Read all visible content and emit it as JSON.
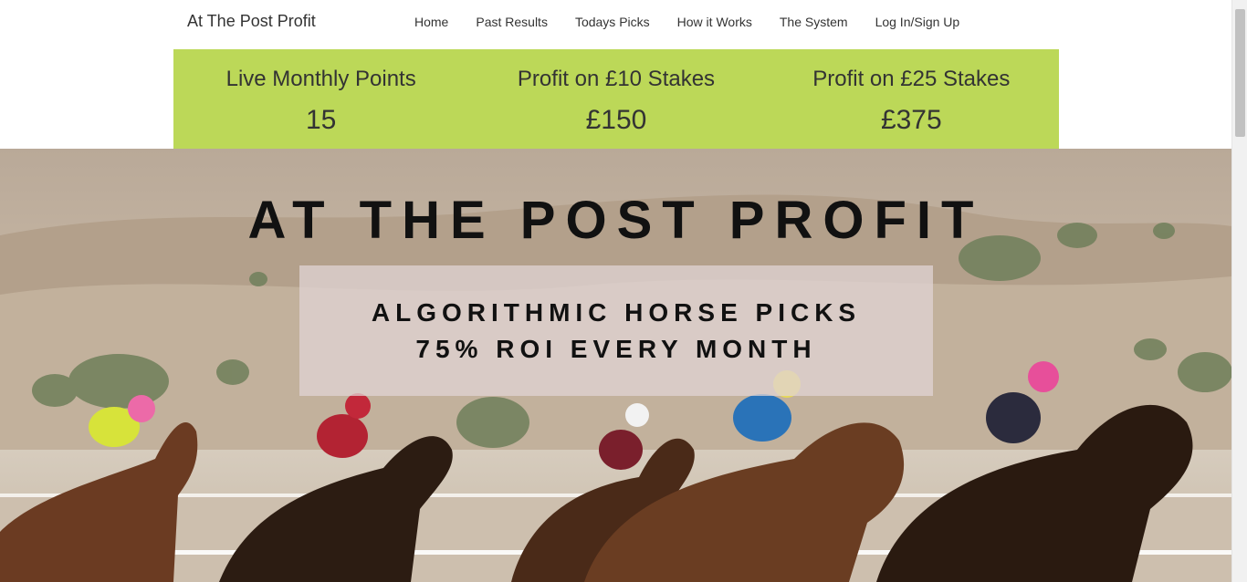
{
  "nav": {
    "brand": "At The Post Profit",
    "links": [
      "Home",
      "Past Results",
      "Todays Picks",
      "How it Works",
      "The System",
      "Log In/Sign Up"
    ]
  },
  "stats": [
    {
      "label": "Live Monthly Points",
      "value": "15"
    },
    {
      "label": "Profit on £10 Stakes",
      "value": "£150"
    },
    {
      "label": "Profit on £25 Stakes",
      "value": "£375"
    }
  ],
  "hero": {
    "title": "AT THE POST PROFIT",
    "line1": "ALGORITHMIC HORSE PICKS",
    "line2": "75% ROI EVERY MONTH",
    "image": "horse-racing-photo"
  },
  "colors": {
    "stats_bar": "#bcd858",
    "text": "#333333",
    "hero_text": "#111111"
  }
}
